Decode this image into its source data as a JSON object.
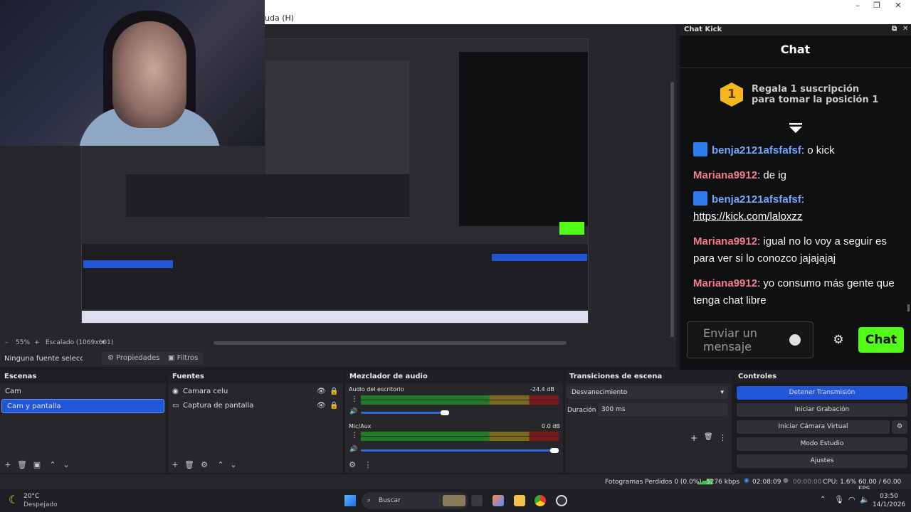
{
  "menu": {
    "partial_item": "uda (H)"
  },
  "preview": {
    "zoom": "55%",
    "scale_mode": "Escalado (1069x601)"
  },
  "chat": {
    "dock_title": "Chat Kick",
    "heading": "Chat",
    "gift": {
      "badge": "1",
      "line1": "Regala 1 suscripción",
      "line2": "para tomar la posición 1"
    },
    "messages": [
      {
        "user": "benja2121afsfafsf",
        "text": "o kick",
        "color": "blue",
        "badge": true
      },
      {
        "user": "Mariana9912",
        "text": "de ig",
        "color": "pink",
        "badge": false
      },
      {
        "user": "benja2121afsfafsf",
        "text": "https://kick.com/laloxzz",
        "color": "blue",
        "badge": true,
        "is_link": true
      },
      {
        "user": "Mariana9912",
        "text": "igual no lo voy a seguir es para ver si lo conozco jajajajaj",
        "color": "pink",
        "badge": false
      },
      {
        "user": "Mariana9912",
        "text": "yo consumo más gente que tenga chat libre",
        "color": "pink",
        "badge": false
      }
    ],
    "input_placeholder": "Enviar un mensaje",
    "send_label": "Chat",
    "colors": {
      "accent": "#53fc18",
      "blue_user": "#73a8ff",
      "pink_user": "#f27b8d"
    }
  },
  "source_bar": {
    "no_source": "Ninguna fuente seleccionada",
    "properties": "Propiedades",
    "filters": "Filtros"
  },
  "scenes": {
    "title": "Escenas",
    "items": [
      "Cam",
      "Cam y pantalla"
    ],
    "selected": "Cam y pantalla"
  },
  "sources": {
    "title": "Fuentes",
    "items": [
      "Camara celu",
      "Captura de pantalla"
    ]
  },
  "mixer": {
    "title": "Mezclador de audio",
    "channels": [
      {
        "name": "Audio del escritorio",
        "db": "-24.4 dB",
        "level": 0.62
      },
      {
        "name": "Mic/Aux",
        "db": "0.0 dB",
        "level": 1.0
      }
    ],
    "scale": [
      "-60",
      "-55",
      "-50",
      "-45",
      "-40",
      "-35",
      "-30",
      "-25",
      "-20",
      "-15",
      "-10",
      "-5",
      "0"
    ]
  },
  "transitions": {
    "title": "Transiciones de escena",
    "selected": "Desvanecimiento",
    "duration_label": "Duración",
    "duration_value": "300 ms"
  },
  "controls": {
    "title": "Controles",
    "buttons": [
      "Detener Transmisión",
      "Iniciar Grabación",
      "Iniciar Cámara Virtual",
      "Modo Estudio",
      "Ajustes"
    ]
  },
  "status": {
    "dropped": "Fotogramas Perdidos 0 (0.0%)",
    "bitrate": "5276 kbps",
    "stream_time": "02:08:09",
    "rec_time": "00:00:00",
    "cpu": "CPU: 1.6%",
    "fps": "60.00 / 60.00 FPS"
  },
  "taskbar": {
    "weather_temp": "20°C",
    "weather_desc": "Despejado",
    "search": "Buscar",
    "time": "03:50",
    "date": "14/1/2026"
  }
}
